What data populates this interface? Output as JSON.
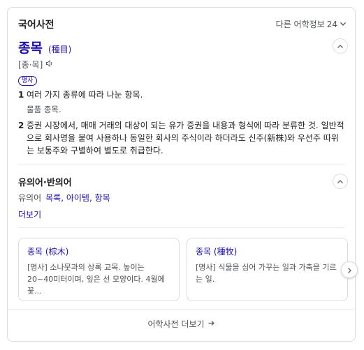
{
  "header": {
    "title": "국어사전",
    "other_info_label": "다른 어학정보",
    "other_info_count": "24"
  },
  "entry": {
    "word": "종목",
    "hanja": "(種目)",
    "pronunciation": "[종·목]",
    "pos": "명사",
    "definitions": [
      {
        "num": "1",
        "text": "여러 가지 종류에 따라 나눈 항목.",
        "example": "물품 종목."
      },
      {
        "num": "2",
        "text": "증권 시장에서, 매매 거래의 대상이 되는 유가 증권을 내용과 형식에 따라 분류한 것. 일반적으로 회사명을 붙여 사용하나 동일한 회사의 주식이라 하더라도 신주(新株)와 우선주 따위는 보통주와 구별하여 별도로 취급한다."
      }
    ]
  },
  "synonyms": {
    "title": "유의어·반의어",
    "label": "유의어",
    "words": "목록, 아이템, 항목",
    "more": "더보기"
  },
  "related": [
    {
      "title": "종목 (棕木)",
      "desc": "[명사] 소나뭇과의 상록 교목. 높이는 20~40미터이며, 잎은 선 모양이다. 4월에 꽃..."
    },
    {
      "title": "종목 (種牧)",
      "desc": "[명사] 식물을 심어 가꾸는 일과 가축을 기르는 일."
    }
  ],
  "footer": {
    "label": "어학사전 더보기"
  },
  "icons": {
    "collapse": "chevron-up-icon",
    "expand": "chevron-down-icon",
    "audio": "speaker-icon",
    "next": "chevron-right-icon",
    "arrow": "arrow-right-icon"
  },
  "colors": {
    "link": "#1a0dab",
    "text": "#202124",
    "muted": "#4d5156",
    "border": "#dadce0"
  }
}
